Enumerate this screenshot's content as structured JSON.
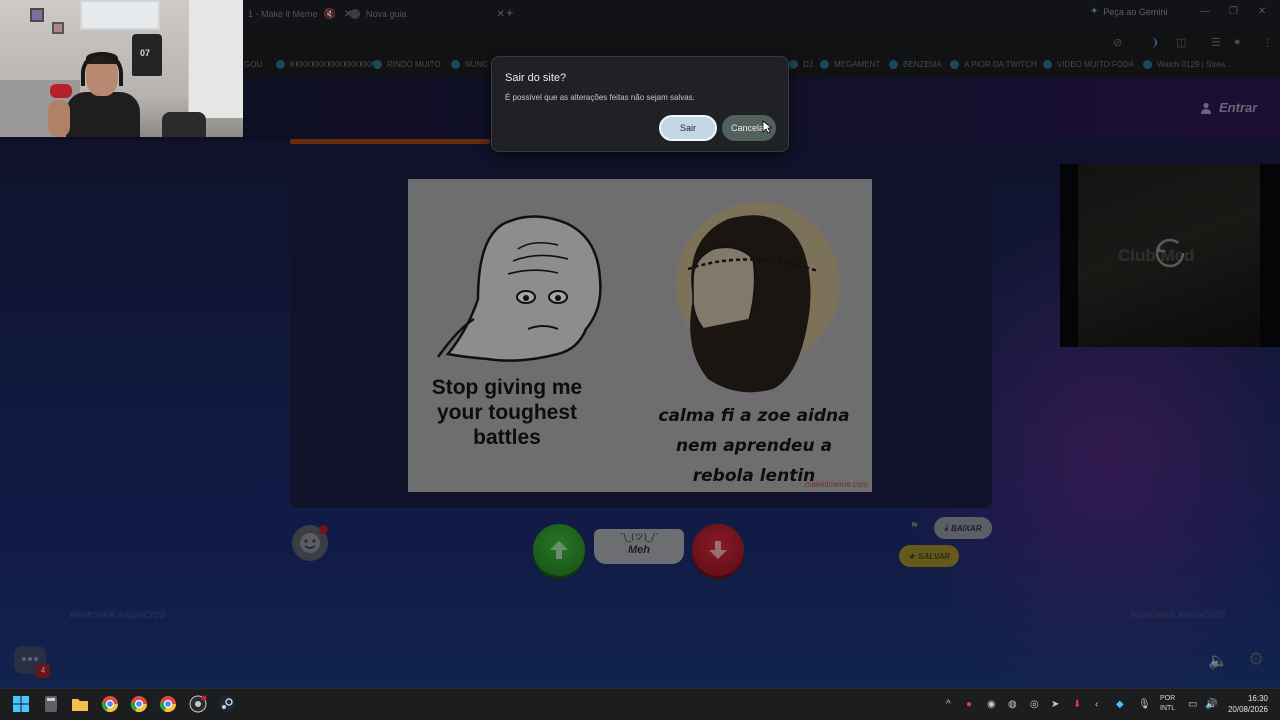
{
  "browser": {
    "tabs": [
      {
        "title": "1 - Make it Meme"
      },
      {
        "title": "Nova guia"
      }
    ],
    "gemini_label": "Peça ao Gemini",
    "bookmarks": [
      "GOU",
      "KKKKKKKKKKKKKKKK",
      "RINDO MUITO",
      "NUNC",
      "DJ",
      "MEGAMENT",
      "BENZEMA",
      "A PIOR DA TWITCH",
      "VIDEO MUITO FODA",
      "Watch 0129 | Strea..."
    ]
  },
  "dialog": {
    "title": "Sair do site?",
    "message": "É possível que as alterações feitas não sejam salvas.",
    "leave_label": "Sair",
    "cancel_label": "Cancelar"
  },
  "site": {
    "login_label": "Entrar",
    "meme": {
      "left_caption": "Stop giving me your toughest battles",
      "right_caption": "calma fi a zoe aidna nem aprendeu a rebola lentin",
      "watermark": "makeitmeme.com"
    },
    "ad_brand": "Club Med",
    "vote": {
      "shrug": "¯\\_(ツ)_/¯",
      "meh_label": "Meh"
    },
    "download_label": "BAIXAR",
    "save_label": "SALVAR",
    "remove_ads_left": "REMOVER ANÚNCIOS",
    "remove_ads_right": "REMOVER ANÚNCIOS",
    "chat_badge": "4"
  },
  "webcam": {
    "shirt_number": "07"
  },
  "taskbar": {
    "lang_line1": "POR",
    "lang_line2": "INTL",
    "time": "16:30",
    "date": "20/08/2026"
  },
  "colors": {
    "upvote": "#2e9a2c",
    "downvote": "#b81c2e",
    "dialog_primary": "#c2d6e6"
  }
}
